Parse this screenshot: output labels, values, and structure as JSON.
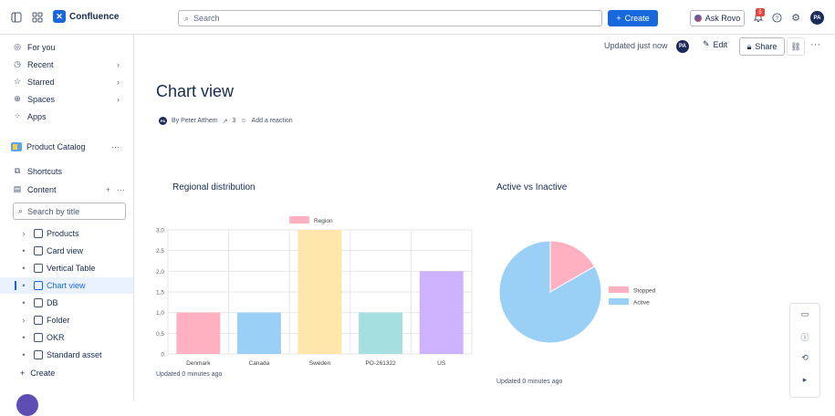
{
  "topbar": {
    "app_name": "Confluence",
    "search_placeholder": "Search",
    "create_label": "Create",
    "rovo_label": "Ask Rovo",
    "notification_count": "5",
    "user_initials": "PA"
  },
  "sidebar": {
    "nav": [
      {
        "label": "For you",
        "icon": "user-circle-icon"
      },
      {
        "label": "Recent",
        "icon": "clock-icon"
      },
      {
        "label": "Starred",
        "icon": "star-icon"
      },
      {
        "label": "Spaces",
        "icon": "globe-icon"
      },
      {
        "label": "Apps",
        "icon": "apps-icon"
      }
    ],
    "space_name": "Product Catalog",
    "shortcuts_label": "Shortcuts",
    "content_label": "Content",
    "search_placeholder": "Search by title",
    "tree": [
      {
        "label": "Products",
        "lead": "chevron"
      },
      {
        "label": "Card view",
        "lead": "dot"
      },
      {
        "label": "Vertical Table",
        "lead": "dot"
      },
      {
        "label": "Chart view",
        "lead": "dot",
        "active": true
      },
      {
        "label": "DB",
        "lead": "dot"
      },
      {
        "label": "Folder",
        "lead": "chevron"
      },
      {
        "label": "OKR",
        "lead": "dot"
      },
      {
        "label": "Standard asset",
        "lead": "dot"
      }
    ],
    "create_label": "Create"
  },
  "page": {
    "updated": "Updated just now",
    "author_initials": "PA",
    "edit_label": "Edit",
    "share_label": "Share",
    "title": "Chart view",
    "byline": "By Peter Atthem",
    "views": "3",
    "reaction": "Add a reaction"
  },
  "chart_data": [
    {
      "type": "bar",
      "title": "Regional distribution",
      "legend": [
        "Region"
      ],
      "legend_placement": "top",
      "categories": [
        "Denmark",
        "Canada",
        "Sweden",
        "PO-261322",
        "US"
      ],
      "values": [
        1.0,
        1.0,
        3.0,
        1.0,
        2.0
      ],
      "colors": [
        "#ffb1c1",
        "#9ad0f5",
        "#ffe6aa",
        "#a5dfdf",
        "#ccb2ff"
      ],
      "ylim": [
        0,
        3
      ],
      "yticks": [
        "0",
        "0,5",
        "1,0",
        "1,5",
        "2,0",
        "2,5",
        "3,0"
      ],
      "grid": true,
      "footer": "Updated 0 minutes ago"
    },
    {
      "type": "pie",
      "title": "Active vs Inactive",
      "labels": [
        "Stopped",
        "Active"
      ],
      "values": [
        1,
        5
      ],
      "colors": [
        "#ffb1c1",
        "#9ad0f5"
      ],
      "legend_placement": "right",
      "footer": "Updated 0 minutes ago"
    }
  ]
}
